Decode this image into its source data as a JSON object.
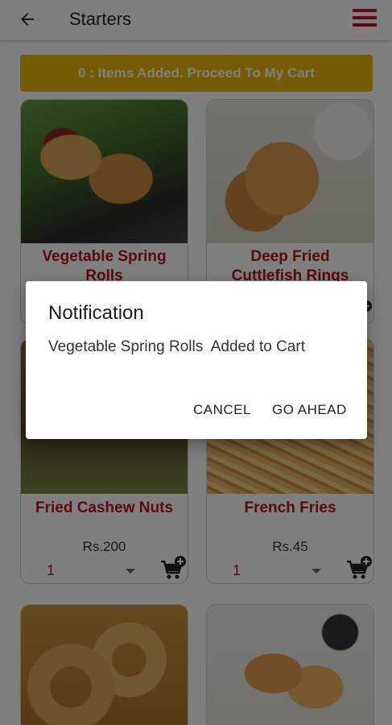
{
  "appbar": {
    "title": "Starters",
    "back_icon": "arrow-left-icon",
    "menu_icon": "hamburger-menu-icon",
    "menu_color": "#c8102e"
  },
  "banner": {
    "text": "0 : Items Added. Proceed To My Cart",
    "color": "#e9b80e"
  },
  "items": [
    {
      "name_line1": "Vegetable Spring",
      "name_line2": "Rolls",
      "image_icon": "spring-rolls-image"
    },
    {
      "name_line1": "Deep Fried",
      "name_line2": "Cuttlefish Rings",
      "image_icon": "cuttlefish-rings-image"
    },
    {
      "name": "Fried Cashew Nuts",
      "price": "Rs.200",
      "qty": "1",
      "image_icon": "cashew-nuts-image"
    },
    {
      "name": "French Fries",
      "price": "Rs.45",
      "qty": "1",
      "image_icon": "french-fries-image"
    },
    {
      "image_icon": "onion-rings-image"
    },
    {
      "image_icon": "fried-shrimp-image"
    }
  ],
  "dialog": {
    "title": "Notification",
    "message": "Vegetable Spring Rolls  Added to Cart",
    "cancel_label": "CANCEL",
    "ahead_label": "GO AHEAD"
  },
  "colors": {
    "accent": "#b3121f",
    "overlay": "rgba(0,0,0,0.5)"
  }
}
